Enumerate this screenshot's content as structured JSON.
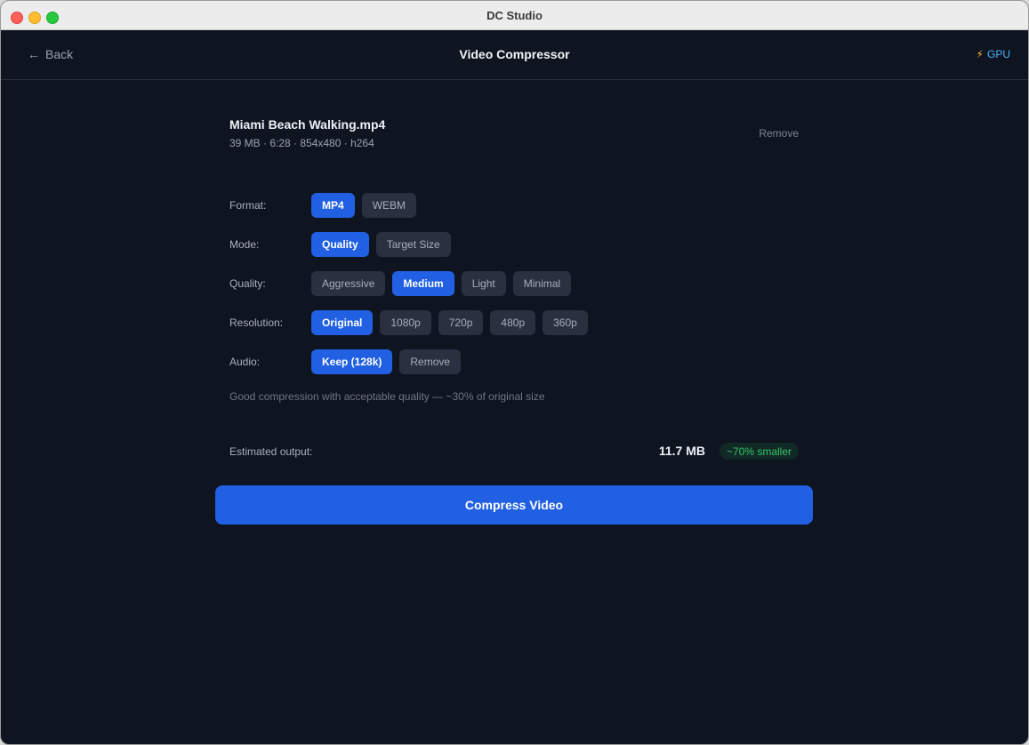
{
  "window": {
    "title": "DC Studio"
  },
  "header": {
    "back_label": "Back",
    "title": "Video Compressor",
    "gpu_label": "GPU"
  },
  "file": {
    "name": "Miami Beach Walking.mp4",
    "meta": "39 MB · 6:28 · 854x480 · h264",
    "remove_label": "Remove"
  },
  "settings": {
    "format": {
      "label": "Format:",
      "options": [
        "MP4",
        "WEBM"
      ],
      "selected": "MP4"
    },
    "mode": {
      "label": "Mode:",
      "options": [
        "Quality",
        "Target Size"
      ],
      "selected": "Quality"
    },
    "quality": {
      "label": "Quality:",
      "options": [
        "Aggressive",
        "Medium",
        "Light",
        "Minimal"
      ],
      "selected": "Medium"
    },
    "resolution": {
      "label": "Resolution:",
      "options": [
        "Original",
        "1080p",
        "720p",
        "480p",
        "360p"
      ],
      "selected": "Original"
    },
    "audio": {
      "label": "Audio:",
      "options": [
        "Keep (128k)",
        "Remove"
      ],
      "selected": "Keep (128k)"
    }
  },
  "hint": "Good compression with acceptable quality — ~30% of original size",
  "estimate": {
    "label": "Estimated output:",
    "size": "11.7 MB",
    "badge": "~70% smaller"
  },
  "action": {
    "compress_label": "Compress Video"
  },
  "colors": {
    "accent": "#2160e3",
    "background": "#0f1421",
    "option_bg": "#293141",
    "success": "#36c46a",
    "gpu": "#4db2f5"
  }
}
